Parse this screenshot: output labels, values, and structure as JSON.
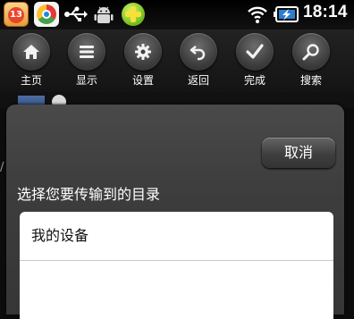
{
  "status_bar": {
    "time": "18:14",
    "notification_icons": [
      "calendar-badge-icon",
      "chrome-icon",
      "usb-icon",
      "android-debug-icon",
      "security-plus-icon"
    ],
    "calendar_badge": "13",
    "system_icons": [
      "wifi-icon",
      "battery-charging-icon"
    ]
  },
  "toolbar": {
    "items": [
      {
        "label": "主页",
        "icon": "home-icon"
      },
      {
        "label": "显示",
        "icon": "list-view-icon"
      },
      {
        "label": "设置",
        "icon": "gear-icon"
      },
      {
        "label": "返回",
        "icon": "back-arrow-icon"
      },
      {
        "label": "完成",
        "icon": "checkmark-icon"
      },
      {
        "label": "搜索",
        "icon": "search-icon"
      }
    ]
  },
  "dialog": {
    "cancel_label": "取消",
    "prompt": "选择您要传输到的目录",
    "folders": [
      {
        "label": "我的设备"
      }
    ]
  },
  "colors": {
    "dialog_bg": "#3d3d3d",
    "list_bg": "#ffffff",
    "toolbar_bg": "#1a1a1a"
  }
}
